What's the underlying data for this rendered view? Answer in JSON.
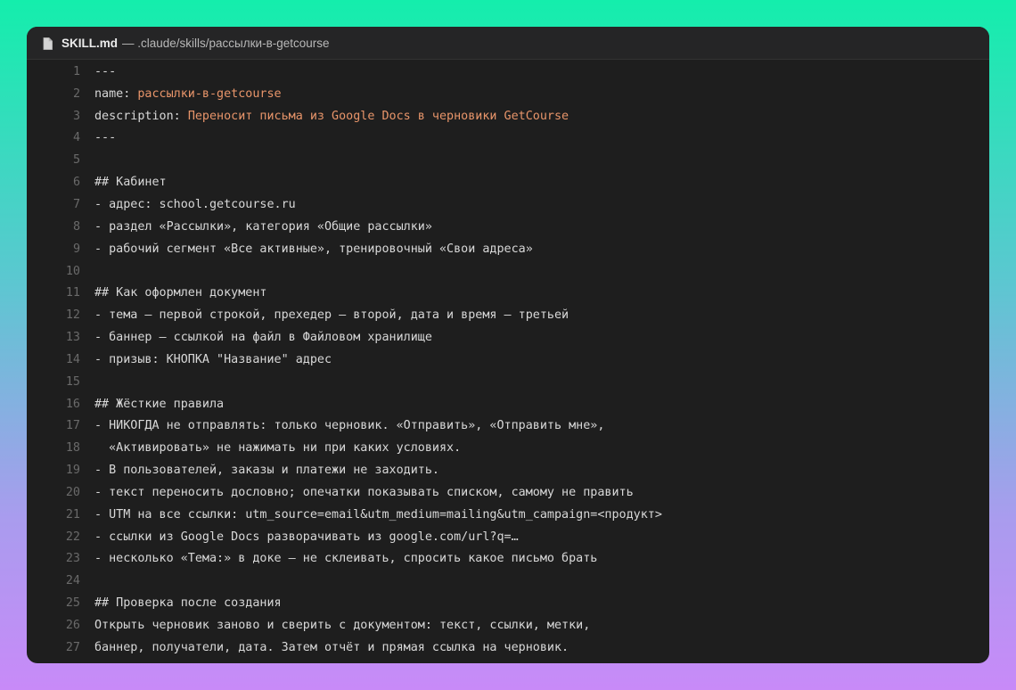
{
  "window": {
    "file_name": "SKILL.md",
    "file_path": "— .claude/skills/рассылки-в-getcourse",
    "file_icon": "document-icon"
  },
  "colors": {
    "background_gradient_top": "#14eeac",
    "background_gradient_bottom": "#c88af8",
    "editor_bg": "#1e1e1e",
    "titlebar_bg": "#252526",
    "text": "#d8d8d8",
    "line_number": "#6a6a6a",
    "yaml_value": "#e8956a"
  },
  "lines": [
    {
      "n": "1",
      "key": "---",
      "val": ""
    },
    {
      "n": "2",
      "key": "name: ",
      "val": "рассылки-в-getcourse"
    },
    {
      "n": "3",
      "key": "description: ",
      "val": "Переносит письма из Google Docs в черновики GetCourse"
    },
    {
      "n": "4",
      "key": "---",
      "val": ""
    },
    {
      "n": "5",
      "key": "",
      "val": ""
    },
    {
      "n": "6",
      "key": "## Кабинет",
      "val": ""
    },
    {
      "n": "7",
      "key": "- адрес: school.getcourse.ru",
      "val": ""
    },
    {
      "n": "8",
      "key": "- раздел «Рассылки», категория «Общие рассылки»",
      "val": ""
    },
    {
      "n": "9",
      "key": "- рабочий сегмент «Все активные», тренировочный «Свои адреса»",
      "val": ""
    },
    {
      "n": "10",
      "key": "",
      "val": ""
    },
    {
      "n": "11",
      "key": "## Как оформлен документ",
      "val": ""
    },
    {
      "n": "12",
      "key": "- тема — первой строкой, прехедер — второй, дата и время — третьей",
      "val": ""
    },
    {
      "n": "13",
      "key": "- баннер — ссылкой на файл в Файловом хранилище",
      "val": ""
    },
    {
      "n": "14",
      "key": "- призыв: КНОПКА \"Название\" адрес",
      "val": ""
    },
    {
      "n": "15",
      "key": "",
      "val": ""
    },
    {
      "n": "16",
      "key": "## Жёсткие правила",
      "val": ""
    },
    {
      "n": "17",
      "key": "- НИКОГДА не отправлять: только черновик. «Отправить», «Отправить мне»,",
      "val": ""
    },
    {
      "n": "18",
      "key": "  «Активировать» не нажимать ни при каких условиях.",
      "val": ""
    },
    {
      "n": "19",
      "key": "- В пользователей, заказы и платежи не заходить.",
      "val": ""
    },
    {
      "n": "20",
      "key": "- текст переносить дословно; опечатки показывать списком, самому не править",
      "val": ""
    },
    {
      "n": "21",
      "key": "- UTM на все ссылки: utm_source=email&utm_medium=mailing&utm_campaign=<продукт>",
      "val": ""
    },
    {
      "n": "22",
      "key": "- ссылки из Google Docs разворачивать из google.com/url?q=…",
      "val": ""
    },
    {
      "n": "23",
      "key": "- несколько «Тема:» в доке — не склеивать, спросить какое письмо брать",
      "val": ""
    },
    {
      "n": "24",
      "key": "",
      "val": ""
    },
    {
      "n": "25",
      "key": "## Проверка после создания",
      "val": ""
    },
    {
      "n": "26",
      "key": "Открыть черновик заново и сверить с документом: текст, ссылки, метки,",
      "val": ""
    },
    {
      "n": "27",
      "key": "баннер, получатели, дата. Затем отчёт и прямая ссылка на черновик.",
      "val": ""
    }
  ]
}
